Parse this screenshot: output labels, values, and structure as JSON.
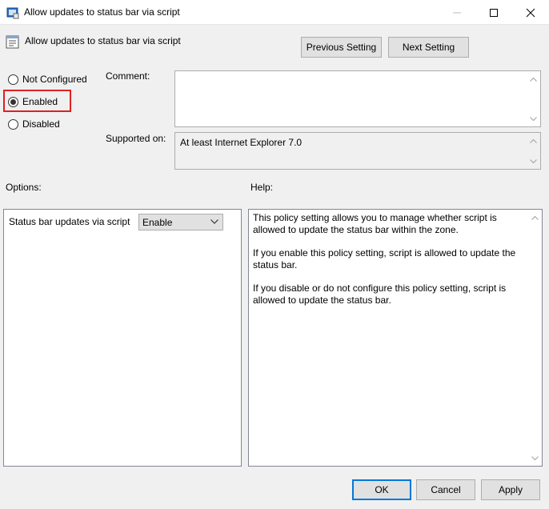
{
  "window": {
    "title": "Allow updates to status bar via script"
  },
  "header": {
    "setting_title": "Allow updates to status bar via script",
    "previous_label": "Previous Setting",
    "next_label": "Next Setting"
  },
  "state": {
    "options": [
      {
        "label": "Not Configured",
        "selected": false
      },
      {
        "label": "Enabled",
        "selected": true
      },
      {
        "label": "Disabled",
        "selected": false
      }
    ]
  },
  "comment": {
    "label": "Comment:",
    "value": ""
  },
  "supported": {
    "label": "Supported on:",
    "value": "At least Internet Explorer 7.0"
  },
  "options_section": {
    "label": "Options:",
    "field_label": "Status bar updates via script",
    "selected_value": "Enable"
  },
  "help_section": {
    "label": "Help:",
    "paragraphs": [
      "This policy setting allows you to manage whether script is allowed to update the status bar within the zone.",
      "If you enable this policy setting, script is allowed to update the status bar.",
      "If you disable or do not configure this policy setting, script is allowed to update the status bar."
    ]
  },
  "footer": {
    "ok_label": "OK",
    "cancel_label": "Cancel",
    "apply_label": "Apply"
  },
  "colors": {
    "highlight": "#e02020",
    "default_button_border": "#0078d7",
    "background": "#f0f0f0"
  }
}
